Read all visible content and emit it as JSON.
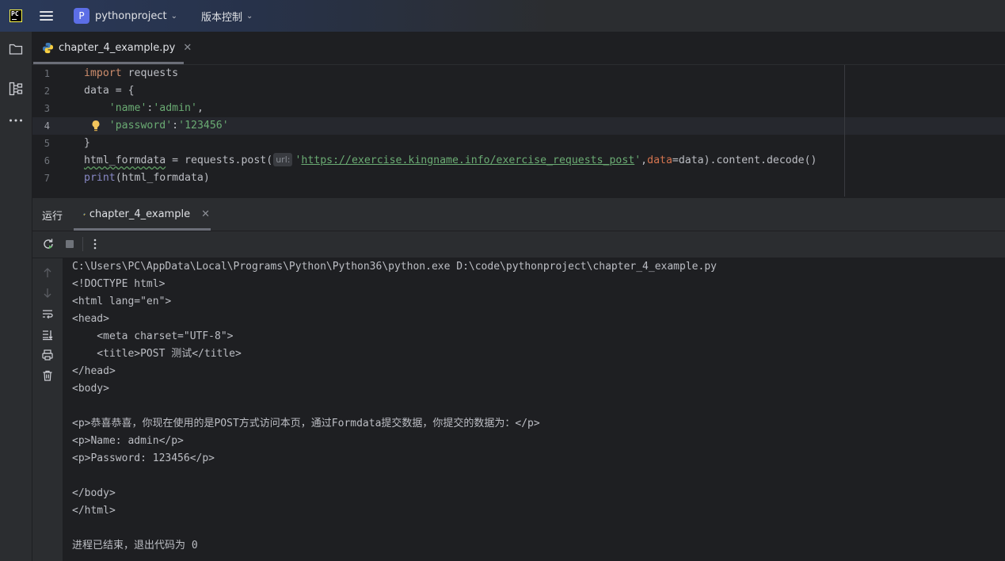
{
  "titlebar": {
    "app_logo_text": "PC",
    "project_initial": "P",
    "project_name": "pythonproject",
    "vcs_label": "版本控制"
  },
  "left_toolbar": {
    "icons": [
      "folder-icon",
      "structure-icon",
      "more-icon"
    ]
  },
  "editor_tab": {
    "filename": "chapter_4_example.py"
  },
  "editor": {
    "line_numbers": [
      "1",
      "2",
      "3",
      "4",
      "5",
      "6",
      "7"
    ],
    "current_line": "4",
    "lines": {
      "l1_kw": "import",
      "l1_rest": " requests",
      "l2": "data = {",
      "l3_indent": "    ",
      "l3_key": "'name'",
      "l3_colon": ":",
      "l3_val": "'admin'",
      "l3_comma": ",",
      "l4_indent": "    ",
      "l4_key": "'password'",
      "l4_colon": ":",
      "l4_val": "'123456'",
      "l5": "}",
      "l6_var": "html_formdata",
      "l6_mid": " = requests.post(",
      "l6_hint": "url:",
      "l6_q1": "'",
      "l6_url": "https://exercise.kingname.info/exercise_requests_post",
      "l6_q2": "'",
      "l6_comma": ",",
      "l6_param": "data",
      "l6_end": "=data).content.decode()",
      "l7_builtin": "print",
      "l7_rest": "(html_formdata)"
    }
  },
  "run_panel": {
    "label": "运行",
    "tab_name": "chapter_4_example"
  },
  "console": {
    "lines": [
      "C:\\Users\\PC\\AppData\\Local\\Programs\\Python\\Python36\\python.exe D:\\code\\pythonproject\\chapter_4_example.py",
      "<!DOCTYPE html>",
      "<html lang=\"en\">",
      "<head>",
      "    <meta charset=\"UTF-8\">",
      "    <title>POST 测试</title>",
      "</head>",
      "<body>",
      "",
      "<p>恭喜恭喜，你现在使用的是POST方式访问本页，通过Formdata提交数据，你提交的数据为：</p>",
      "<p>Name: admin</p>",
      "<p>Password: 123456</p>",
      "",
      "</body>",
      "</html>",
      "",
      "进程已结束，退出代码为 0"
    ]
  },
  "colors": {
    "accent": "#3574f0",
    "keyword": "#cf8e6d",
    "string": "#6aab73",
    "builtin": "#8888c6",
    "param": "#d5744f"
  }
}
